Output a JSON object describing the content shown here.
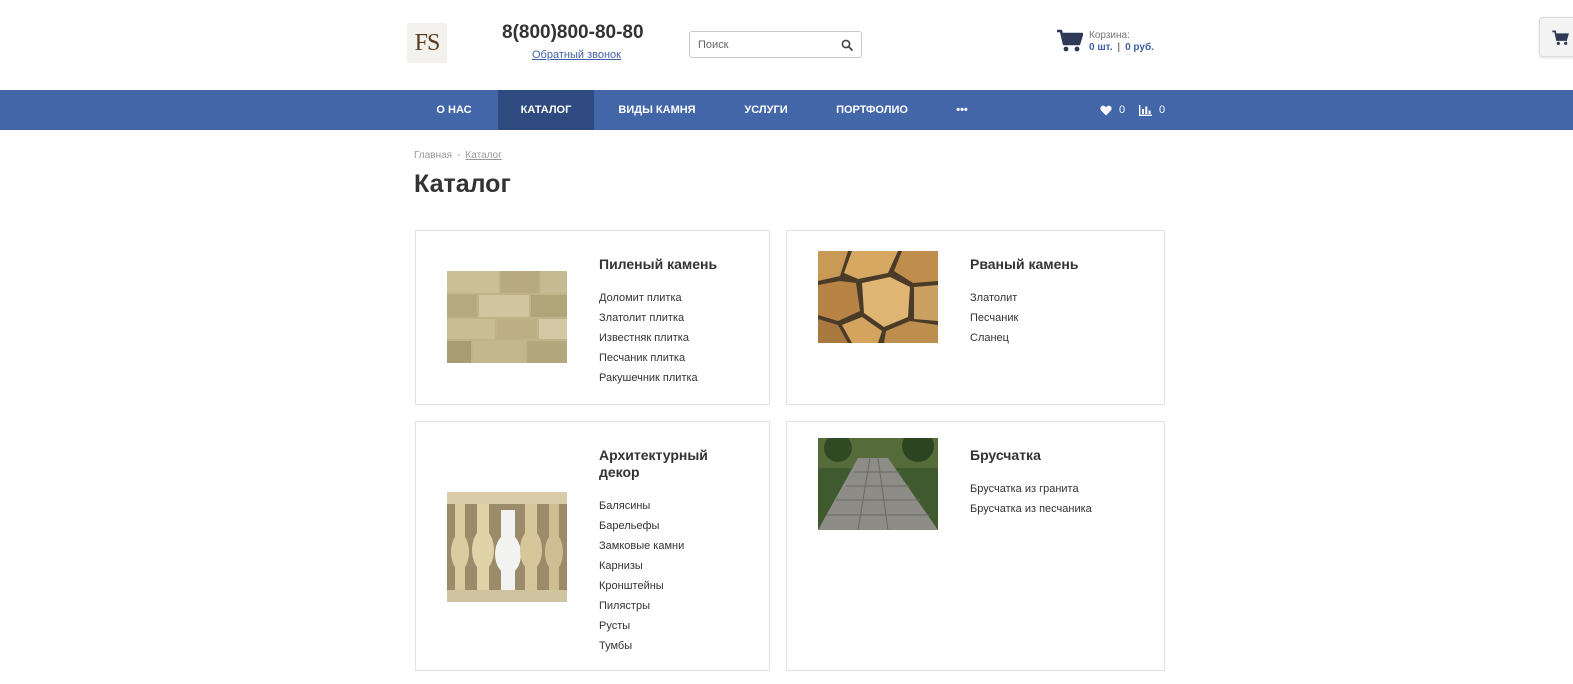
{
  "header": {
    "logo_text": "FS",
    "phone": "8(800)800-80-80",
    "callback_label": "Обратный звонок",
    "search_placeholder": "Поиск",
    "cart_label": "Корзина:",
    "cart_count": "0 шт.",
    "cart_separator": "|",
    "cart_total": "0 руб."
  },
  "nav": {
    "items": [
      {
        "label": "О НАС"
      },
      {
        "label": "КАТАЛОГ"
      },
      {
        "label": "ВИДЫ КАМНЯ"
      },
      {
        "label": "УСЛУГИ"
      },
      {
        "label": "ПОРТФОЛИО"
      },
      {
        "label": "•••"
      }
    ],
    "favorites_count": "0",
    "compare_count": "0"
  },
  "breadcrumb": {
    "home": "Главная",
    "separator": "-",
    "current": "Каталог"
  },
  "page_title": "Каталог",
  "categories": [
    {
      "title": "Пиленый камень",
      "links": [
        "Доломит плитка",
        "Златолит плитка",
        "Известняк плитка",
        "Песчаник плитка",
        "Ракушечник плитка"
      ]
    },
    {
      "title": "Рваный камень",
      "links": [
        "Златолит",
        "Песчаник",
        "Сланец"
      ]
    },
    {
      "title": "Архитектурный декор",
      "links": [
        "Балясины",
        "Барельефы",
        "Замковые камни",
        "Карнизы",
        "Кронштейны",
        "Пилястры",
        "Русты",
        "Тумбы"
      ]
    },
    {
      "title": "Брусчатка",
      "links": [
        "Брусчатка из гранита",
        "Брусчатка из песчаника"
      ]
    }
  ],
  "colors": {
    "nav_bg": "#4266a8",
    "nav_active": "#2e4a7e",
    "link_blue": "#3f5fa3",
    "text_dark": "#333333"
  }
}
